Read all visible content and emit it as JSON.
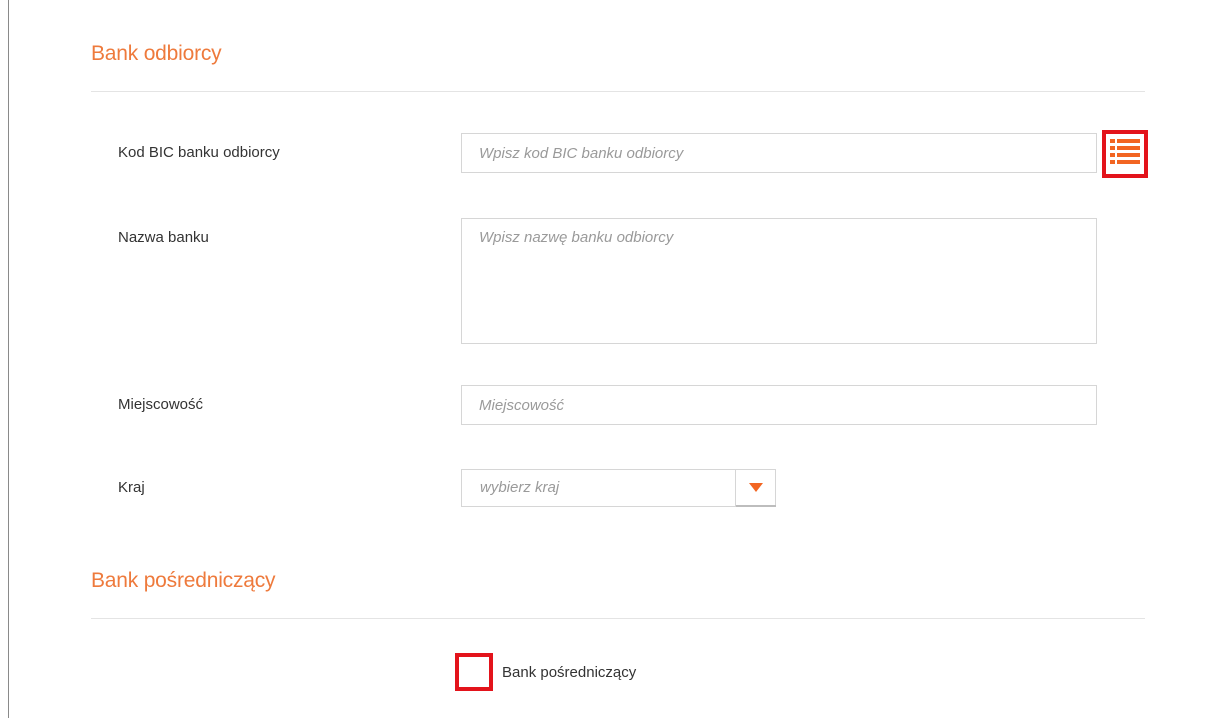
{
  "recipient_bank": {
    "title": "Bank odbiorcy",
    "bic_label": "Kod BIC banku odbiorcy",
    "bic_placeholder": "Wpisz kod BIC banku odbiorcy",
    "bic_value": "",
    "bank_list_icon": "list-icon",
    "bank_name_label": "Nazwa banku",
    "bank_name_placeholder": "Wpisz nazwę banku odbiorcy",
    "bank_name_value": "",
    "city_label": "Miejscowość",
    "city_placeholder": "Miejscowość",
    "city_value": "",
    "country_label": "Kraj",
    "country_value": "wybierz kraj",
    "country_dropdown_icon": "caret-down-icon"
  },
  "intermediary_bank": {
    "title": "Bank pośredniczący",
    "checkbox_label": "Bank pośredniczący",
    "checkbox_checked": false
  },
  "colors": {
    "accent": "#ee7a3c",
    "highlight": "#e3131b",
    "icon": "#f26522",
    "caret": "#f26522"
  }
}
